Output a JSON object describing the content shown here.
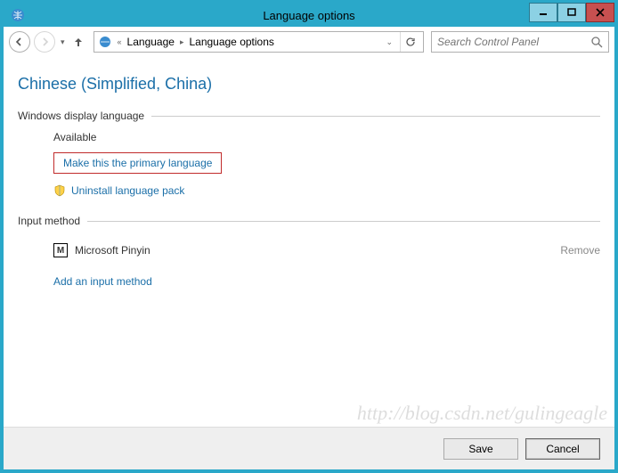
{
  "title": "Language options",
  "breadcrumb": {
    "item1": "Language",
    "item2": "Language options"
  },
  "search": {
    "placeholder": "Search Control Panel"
  },
  "language_title": "Chinese (Simplified, China)",
  "display_group": {
    "label": "Windows display language",
    "status": "Available",
    "primary_link": "Make this the primary language",
    "uninstall_link": "Uninstall language pack"
  },
  "input_group": {
    "label": "Input method",
    "methods": [
      {
        "icon": "M",
        "name": "Microsoft Pinyin",
        "remove_label": "Remove"
      }
    ],
    "add_link": "Add an input method"
  },
  "footer": {
    "save": "Save",
    "cancel": "Cancel"
  },
  "watermark": "http://blog.csdn.net/gulingeagle"
}
